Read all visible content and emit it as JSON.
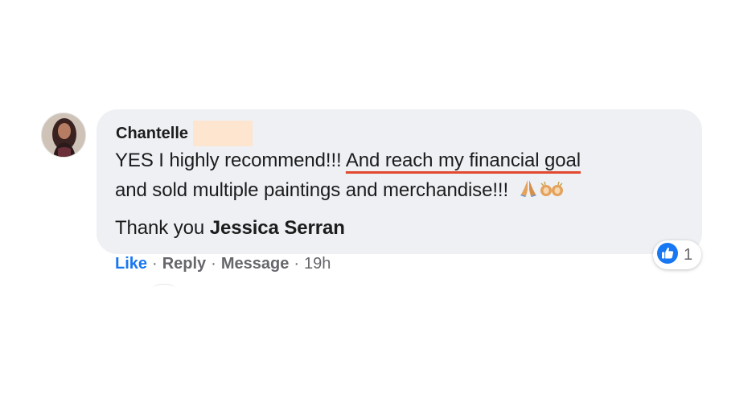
{
  "comment": {
    "author": "Chantelle",
    "text": {
      "line1_prefix": "YES I highly recommend!!! ",
      "line1_highlight": "And reach my financial goal",
      "line2": "and sold multiple paintings and merchandise!!!",
      "line3_prefix": "Thank you ",
      "mention": "Jessica Serran"
    },
    "emojis": [
      "praying-hands-icon",
      "raising-hands-icon"
    ]
  },
  "reaction": {
    "icon": "like-icon",
    "count": "1"
  },
  "actions": {
    "like": "Like",
    "reply": "Reply",
    "message": "Message",
    "time": "19h",
    "separator": "·"
  },
  "colors": {
    "bubble": "#eef0f4",
    "like_blue": "#1877f2",
    "underline": "#e2492e",
    "redaction": "#fde5cf",
    "meta_gray": "#65676b"
  }
}
